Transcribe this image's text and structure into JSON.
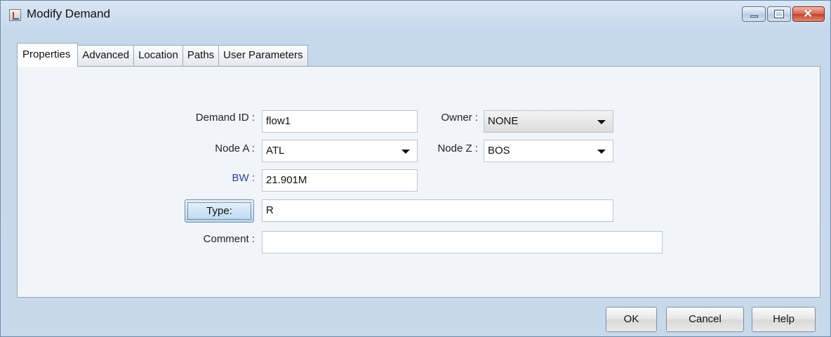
{
  "window": {
    "title": "Modify Demand",
    "icon": "java-app-icon",
    "controls": {
      "minimize": "minimize-icon",
      "maximize": "maximize-icon",
      "close_glyph": "✕"
    }
  },
  "tabs": [
    {
      "label": "Properties",
      "active": true
    },
    {
      "label": "Advanced",
      "active": false
    },
    {
      "label": "Location",
      "active": false
    },
    {
      "label": "Paths",
      "active": false
    },
    {
      "label": "User Parameters",
      "active": false
    }
  ],
  "form": {
    "demand_id": {
      "label": "Demand ID :",
      "value": "flow1"
    },
    "owner": {
      "label": "Owner :",
      "value": "NONE"
    },
    "node_a": {
      "label": "Node A :",
      "value": "ATL"
    },
    "node_z": {
      "label": "Node Z :",
      "value": "BOS"
    },
    "bw": {
      "label": "BW :",
      "value": "21.901M",
      "label_color": "#2a3fa8"
    },
    "type": {
      "button_label": "Type:",
      "value": "R"
    },
    "comment": {
      "label": "Comment :",
      "value": ""
    }
  },
  "buttons": {
    "ok": "OK",
    "cancel": "Cancel",
    "help": "Help"
  }
}
